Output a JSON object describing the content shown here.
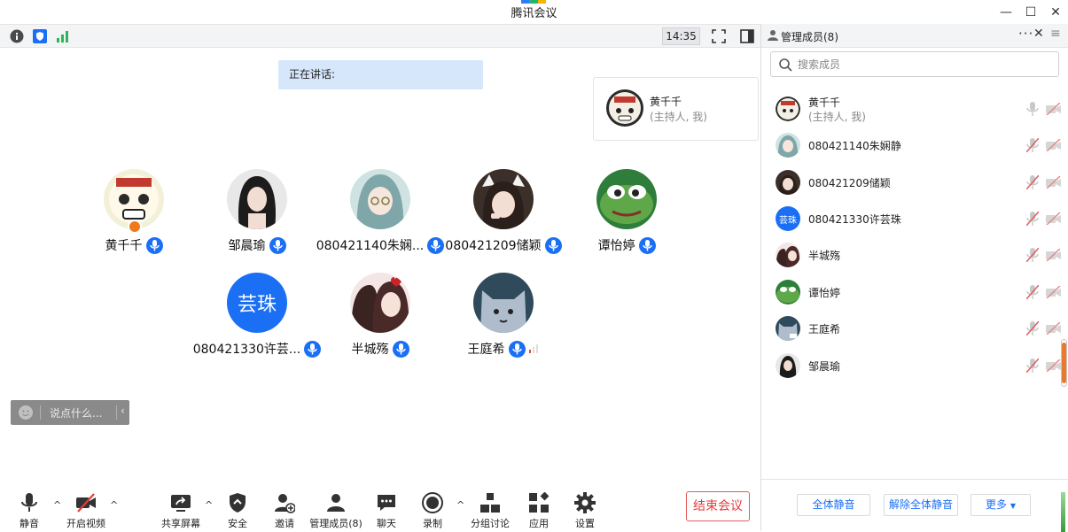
{
  "app": {
    "title": "腾讯会议",
    "brand_colors": [
      "#2d7df6",
      "#26b36a",
      "#f5b400",
      "#e34c3a"
    ]
  },
  "window_controls": {
    "minimize": "—",
    "maximize": "☐",
    "close": "✕"
  },
  "infobar": {
    "time": "14:35"
  },
  "speaking": {
    "label": "正在讲话:"
  },
  "host_card": {
    "name": "黄千千",
    "role": "(主持人, 我)"
  },
  "tiles": [
    {
      "name": "黄千千",
      "avatar": "cow",
      "mic": "on",
      "host": true
    },
    {
      "name": "邹晨瑜",
      "avatar": "girl-dark",
      "mic": "on"
    },
    {
      "name": "080421140朱娴...",
      "avatar": "anime-teal",
      "mic": "on"
    },
    {
      "name": "080421209储颖",
      "avatar": "girl-cat",
      "mic": "on"
    },
    {
      "name": "谭怡婷",
      "avatar": "frog",
      "mic": "on"
    },
    {
      "name": "080421330许芸...",
      "avatar": "text",
      "avatar_text": "芸珠",
      "mic": "on"
    },
    {
      "name": "半城殇",
      "avatar": "anime-couple",
      "mic": "on"
    },
    {
      "name": "王庭希",
      "avatar": "cat-grey",
      "mic": "on",
      "signal": true
    }
  ],
  "chat": {
    "placeholder": "说点什么...",
    "collapse": "‹"
  },
  "toolbar": {
    "mute": "静音",
    "video": "开启视频",
    "share": "共享屏幕",
    "security": "安全",
    "invite": "邀请",
    "members": "管理成员(8)",
    "chat": "聊天",
    "record": "录制",
    "breakout": "分组讨论",
    "apps": "应用",
    "settings": "设置",
    "end": "结束会议",
    "caret": "^"
  },
  "panel": {
    "title": "管理成员(8)",
    "more": "···",
    "close": "✕",
    "menu": "≡",
    "search_placeholder": "搜索成员",
    "members": [
      {
        "name": "黄千千",
        "sub": "(主持人, 我)",
        "avatar": "cow",
        "mic": "on"
      },
      {
        "name": "080421140朱娴静",
        "avatar": "anime-teal",
        "mic": "off"
      },
      {
        "name": "080421209储颖",
        "avatar": "girl-cat",
        "mic": "off"
      },
      {
        "name": "080421330许芸珠",
        "avatar": "text",
        "avatar_text": "芸珠",
        "mic": "off"
      },
      {
        "name": "半城殇",
        "avatar": "anime-couple",
        "mic": "off"
      },
      {
        "name": "谭怡婷",
        "avatar": "frog",
        "mic": "off"
      },
      {
        "name": "王庭希",
        "avatar": "cat-grey",
        "mic": "off"
      },
      {
        "name": "邹晨瑜",
        "avatar": "girl-dark",
        "mic": "off"
      }
    ],
    "footer": {
      "mute_all": "全体静音",
      "unmute_all": "解除全体静音",
      "more": "更多"
    }
  }
}
